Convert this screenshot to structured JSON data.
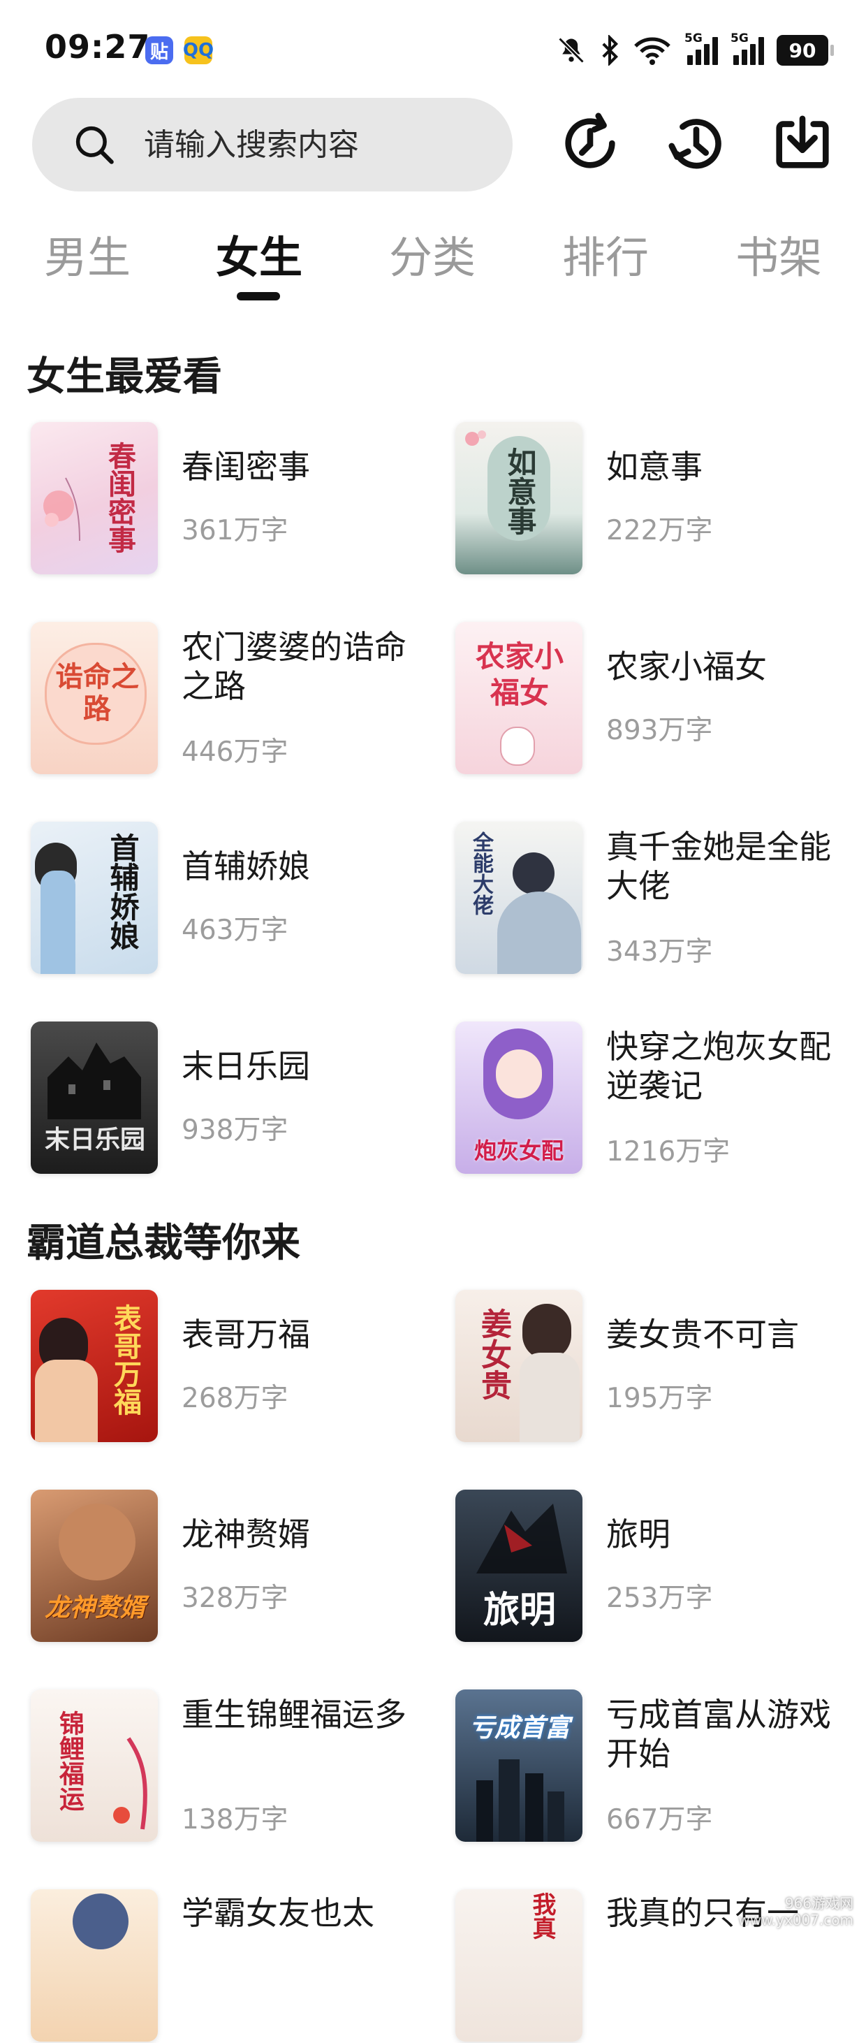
{
  "status_bar": {
    "time": "09:27",
    "app_icons": [
      "贴",
      "QQ"
    ],
    "net_labels": [
      "5G",
      "5G"
    ],
    "battery": "90",
    "icons": [
      "bell-off-icon",
      "bluetooth-icon",
      "wifi-icon",
      "signal-icon",
      "signal-icon",
      "battery-icon"
    ]
  },
  "search": {
    "placeholder": "请输入搜索内容"
  },
  "toolbar": {
    "icons": [
      "refresh-icon",
      "history-icon",
      "download-icon"
    ]
  },
  "tabs": [
    {
      "label": "男生",
      "active": false
    },
    {
      "label": "女生",
      "active": true
    },
    {
      "label": "分类",
      "active": false
    },
    {
      "label": "排行",
      "active": false
    },
    {
      "label": "书架",
      "active": false
    }
  ],
  "sections": [
    {
      "title": "女生最爱看",
      "books": [
        {
          "title": "春闺密事",
          "words": "361万字",
          "cover_text": "春闺密事",
          "cover_bg": "#f6dfe6",
          "cover_fg": "#c22a45"
        },
        {
          "title": "如意事",
          "words": "222万字",
          "cover_text": "如意事",
          "cover_bg": "#d8e4df",
          "cover_fg": "#2a3a34"
        },
        {
          "title": "农门婆婆的诰命之路",
          "words": "446万字",
          "cover_text": "诰命之路",
          "cover_bg": "#fbe1d6",
          "cover_fg": "#d94a34"
        },
        {
          "title": "农家小福女",
          "words": "893万字",
          "cover_text": "农家小福女",
          "cover_bg": "#fbe4e8",
          "cover_fg": "#d8334f"
        },
        {
          "title": "首辅娇娘",
          "words": "463万字",
          "cover_text": "首辅娇娘",
          "cover_bg": "#dde8f2",
          "cover_fg": "#151515"
        },
        {
          "title": "真千金她是全能大佬",
          "words": "343万字",
          "cover_text": "全能大佬",
          "cover_bg": "#e3e8ee",
          "cover_fg": "#2c3c6a"
        },
        {
          "title": "末日乐园",
          "words": "938万字",
          "cover_text": "末日乐园",
          "cover_bg": "#2b2b2b",
          "cover_fg": "#e8e8e8"
        },
        {
          "title": "快穿之炮灰女配逆袭记",
          "words": "1216万字",
          "cover_text": "炮灰女配",
          "cover_bg": "#d9c7ef",
          "cover_fg": "#d21d4a"
        }
      ]
    },
    {
      "title": "霸道总裁等你来",
      "books": [
        {
          "title": "表哥万福",
          "words": "268万字",
          "cover_text": "表哥万福",
          "cover_bg": "#c8201c",
          "cover_fg": "#ffd85a"
        },
        {
          "title": "姜女贵不可言",
          "words": "195万字",
          "cover_text": "姜女贵",
          "cover_bg": "#f1e7e0",
          "cover_fg": "#b4243a"
        },
        {
          "title": "龙神赘婿",
          "words": "328万字",
          "cover_text": "龙神赘婿",
          "cover_bg": "#b5714a",
          "cover_fg": "#ff9a2a"
        },
        {
          "title": "旅明",
          "words": "253万字",
          "cover_text": "旅明",
          "cover_bg": "#1f2833",
          "cover_fg": "#ffffff"
        },
        {
          "title": "重生锦鲤福运多",
          "words": "138万字",
          "cover_text": "锦鲤福运",
          "cover_bg": "#f4ece6",
          "cover_fg": "#c8243a"
        },
        {
          "title": "亏成首富从游戏开始",
          "words": "667万字",
          "cover_text": "亏成首富",
          "cover_bg": "#3c4f66",
          "cover_fg": "#ffffff"
        },
        {
          "title": "学霸女友也太",
          "words": "",
          "cover_text": "",
          "cover_bg": "#fbeede",
          "cover_fg": "#333333"
        },
        {
          "title": "我真的只有一",
          "words": "",
          "cover_text": "我真",
          "cover_bg": "#f6f0ec",
          "cover_fg": "#c31d2a"
        }
      ]
    }
  ],
  "watermark": [
    "966游戏网",
    "www.yx007.com"
  ],
  "colors": {
    "active_tab": "#111111",
    "inactive_tab": "#9a9a9a",
    "search_bg": "#e7e7e7",
    "words": "#9c9c9c"
  }
}
